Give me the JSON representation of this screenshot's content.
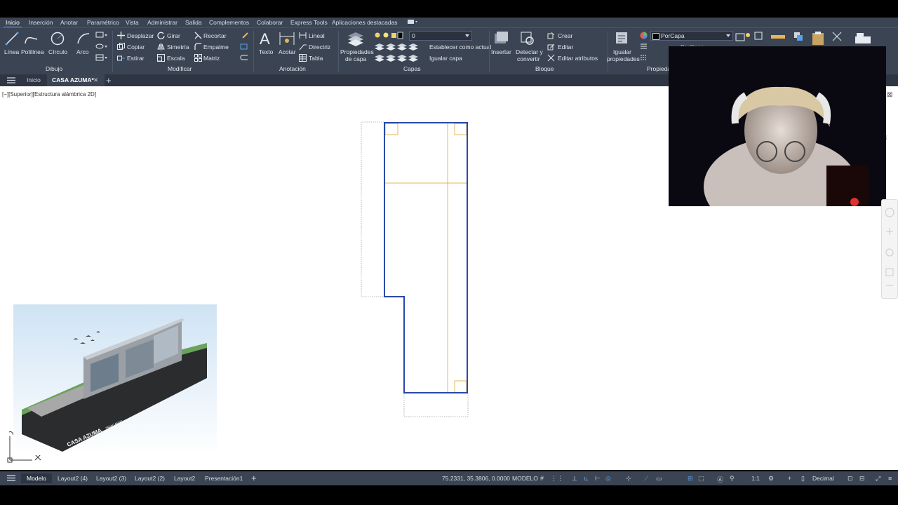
{
  "ribbon": {
    "tabs": [
      "Inicio",
      "Inserción",
      "Anotar",
      "Paramétrico",
      "Vista",
      "Administrar",
      "Salida",
      "Complementos",
      "Colaborar",
      "Express Tools",
      "Aplicaciones destacadas"
    ],
    "draw": {
      "linea": "Línea",
      "polilinea": "Polilínea",
      "circulo": "Círculo",
      "arco": "Arco",
      "title": "Dibujo"
    },
    "modify": {
      "desplazar": "Desplazar",
      "girar": "Girar",
      "recortar": "Recortar",
      "copiar": "Copiar",
      "simetria": "Simetría",
      "empalme": "Empalme",
      "estirar": "Estirar",
      "escala": "Escala",
      "matriz": "Matriz",
      "title": "Modificar"
    },
    "annotation": {
      "texto": "Texto",
      "acotar": "Acotar",
      "lineal": "Lineal",
      "directriz": "Directriz",
      "tabla": "Tabla",
      "title": "Anotación"
    },
    "layers": {
      "propiedades1": "Propiedades",
      "propiedades2": "de capa",
      "current_layer": "0",
      "establecer": "Establecer como actual",
      "igualar": "Igualar capa",
      "title": "Capas"
    },
    "block": {
      "insertar": "Insertar",
      "detectar1": "Detectar y",
      "detectar2": "convertir",
      "crear": "Crear",
      "editar": "Editar",
      "editar_atributos": "Editar atributos",
      "title": "Bloque"
    },
    "properties": {
      "igualar1": "Igualar",
      "igualar2": "propiedades",
      "color_value": "PorCapa",
      "linetype_value": "PorCapa",
      "title": "Propieda"
    }
  },
  "doc_tabs": {
    "inicio": "Inicio",
    "active": "CASA AZUMA*"
  },
  "viewport_label": "[−][Superior][Estructura alámbrica 2D]",
  "status": {
    "tabs": [
      "Modelo",
      "Layout2 (4)",
      "Layout2 (3)",
      "Layout2 (2)",
      "Layout2",
      "Presentación1"
    ],
    "coords": "75.2331, 35.3806, 0.0000",
    "space": "MODELO",
    "scale": "1:1",
    "units": "Decimal"
  },
  "thumbnail": {
    "caption": "CASA AZUMA",
    "subcaption": "TADAO ANDO"
  },
  "colors": {
    "ribbon": "#3b4453",
    "plan_outline": "#2a49a8",
    "plan_inner": "#e8b454",
    "canvas": "#ffffff"
  }
}
